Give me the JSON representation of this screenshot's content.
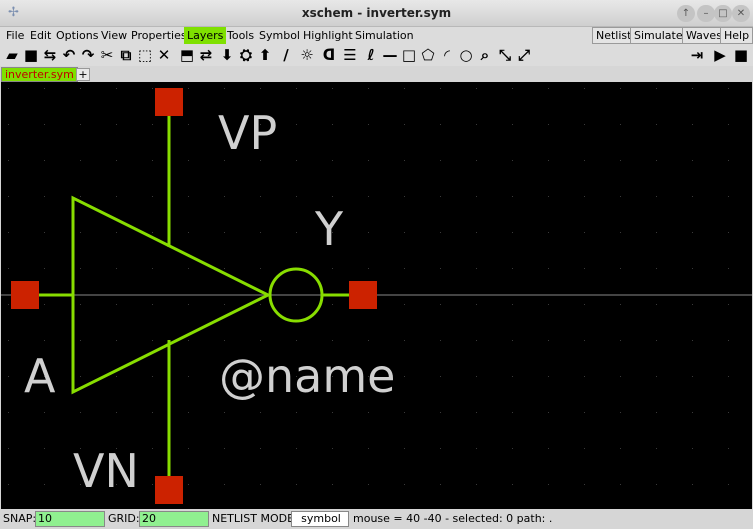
{
  "window": {
    "title": "xschem - inverter.sym",
    "buttons": [
      "↑",
      "–",
      "□",
      "✕"
    ]
  },
  "menu": {
    "items": [
      "File",
      "Edit",
      "Options",
      "View",
      "Properties",
      "Layers",
      "Tools",
      "Symbol",
      "Highlight",
      "Simulation"
    ],
    "active": "Layers",
    "right_items": [
      "Netlist",
      "Simulate",
      "Waves",
      "Help"
    ]
  },
  "toolbar": {
    "left_icons": [
      "open-folder-icon",
      "save-icon",
      "reload-icon",
      "undo-icon",
      "redo-icon",
      "cut-icon",
      "copy-icon",
      "move-icon",
      "delete-icon",
      "push-icon",
      "swap-icon",
      "down-icon",
      "netlist-icon",
      "up-icon",
      "pencil-icon",
      "light-icon",
      "gate-icon",
      "list-icon",
      "pin-icon",
      "line-icon",
      "rect-icon",
      "polygon-icon",
      "arc-icon",
      "circle-icon",
      "search-icon",
      "zoom-in-icon",
      "zoom-out-icon"
    ],
    "left_glyphs": [
      "▰",
      "■",
      "⇆",
      "↶",
      "↷",
      "✂",
      "⧉",
      "⬚",
      "✕",
      "⬒",
      "⇄",
      "⬇",
      "⛭",
      "⬆",
      "∕",
      "☼",
      "ᗡ",
      "☰",
      "ℓ",
      "—",
      "□",
      "⬠",
      "◜",
      "○",
      "⌕",
      "⤡",
      "⤢"
    ],
    "right_icons": [
      "step-in-icon",
      "play-icon",
      "stop-icon"
    ],
    "right_glyphs": [
      "⇥",
      "▶",
      "■"
    ]
  },
  "tabs": {
    "active_label": "inverter.sym",
    "add_label": "+"
  },
  "schematic": {
    "colors": {
      "background": "#000000",
      "wire": "#88dd00",
      "pin": "#cc2200",
      "text": "#d0d0d0",
      "axis": "#444444"
    },
    "labels": {
      "vp": "VP",
      "vn": "VN",
      "a": "A",
      "y": "Y",
      "name": "@name"
    }
  },
  "status": {
    "snap_label": "SNAP:",
    "snap_value": "10",
    "grid_label": "GRID:",
    "grid_value": "20",
    "netlist_mode_label": "NETLIST MODE:",
    "netlist_mode_value": "symbol",
    "info": "mouse = 40 -40 - selected: 0 path: ."
  }
}
